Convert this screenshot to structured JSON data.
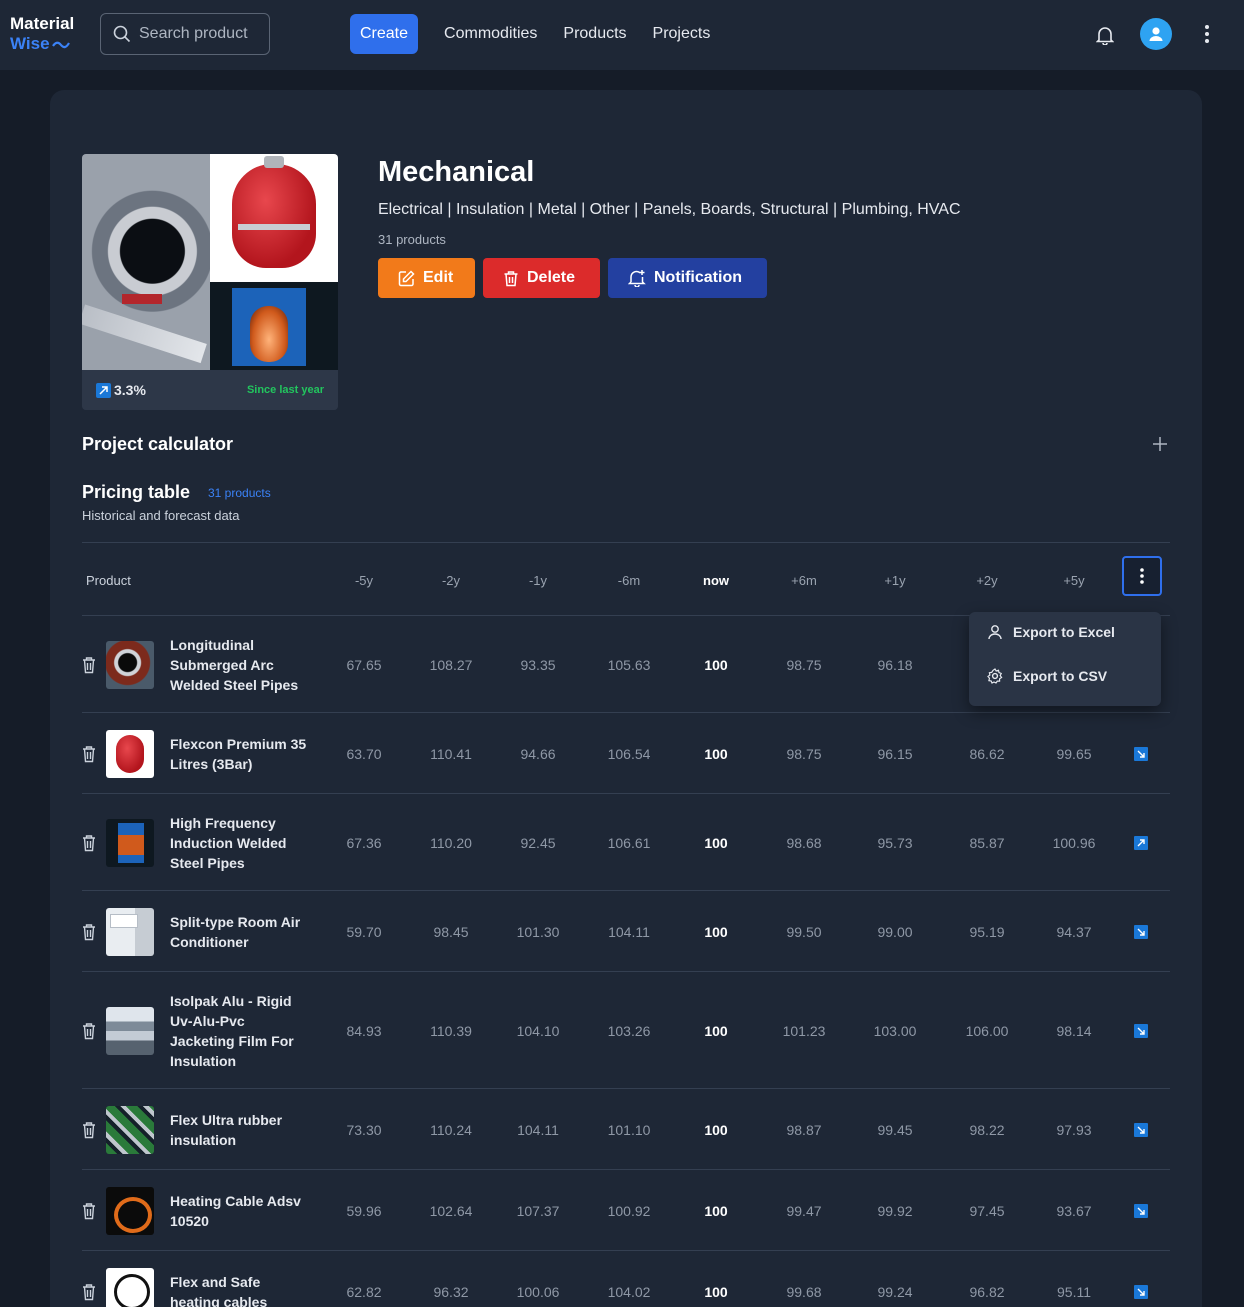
{
  "topbar": {
    "logo_line1": "Material",
    "logo_line2": "Wise",
    "search_placeholder": "Search product",
    "nav": {
      "create": "Create",
      "commodities": "Commodities",
      "products": "Products",
      "projects": "Projects"
    },
    "icons": [
      "search-icon",
      "bell-icon",
      "user-avatar-icon",
      "more-vertical-icon"
    ]
  },
  "category": {
    "title": "Mechanical",
    "subcategories": "Electrical | Insulation | Metal | Other | Panels, Boards, Structural | Plumbing, HVAC",
    "product_count": "31 products",
    "trend_value": "3.3%",
    "trend_label": "Since last year",
    "buttons": {
      "edit": "Edit",
      "delete": "Delete",
      "notification": "Notification"
    }
  },
  "project_calculator": {
    "title": "Project calculator",
    "add_icon": "plus-icon"
  },
  "pricing_table": {
    "title": "Pricing table",
    "count": "31 products",
    "subtitle": "Historical and forecast data",
    "columns": [
      "Product",
      "-5y",
      "-2y",
      "-1y",
      "-6m",
      "now",
      "+6m",
      "+1y",
      "+2y",
      "+5y"
    ],
    "rows": [
      {
        "name": "Longitudinal Submerged Arc Welded Steel Pipes",
        "values": [
          "67.65",
          "108.27",
          "93.35",
          "105.63",
          "100",
          "98.75",
          "96.18",
          "",
          ""
        ],
        "trend": ""
      },
      {
        "name": "Flexcon Premium 35 Litres (3Bar)",
        "values": [
          "63.70",
          "110.41",
          "94.66",
          "106.54",
          "100",
          "98.75",
          "96.15",
          "86.62",
          "99.65"
        ],
        "trend": "down"
      },
      {
        "name": "High Frequency Induction Welded Steel Pipes",
        "values": [
          "67.36",
          "110.20",
          "92.45",
          "106.61",
          "100",
          "98.68",
          "95.73",
          "85.87",
          "100.96"
        ],
        "trend": "up"
      },
      {
        "name": "Split-type Room Air Conditioner",
        "values": [
          "59.70",
          "98.45",
          "101.30",
          "104.11",
          "100",
          "99.50",
          "99.00",
          "95.19",
          "94.37"
        ],
        "trend": "down"
      },
      {
        "name": "Isolpak Alu - Rigid Uv-Alu-Pvc Jacketing Film For Insulation",
        "values": [
          "84.93",
          "110.39",
          "104.10",
          "103.26",
          "100",
          "101.23",
          "103.00",
          "106.00",
          "98.14"
        ],
        "trend": "down"
      },
      {
        "name": "Flex Ultra rubber insulation",
        "values": [
          "73.30",
          "110.24",
          "104.11",
          "101.10",
          "100",
          "98.87",
          "99.45",
          "98.22",
          "97.93"
        ],
        "trend": "down"
      },
      {
        "name": "Heating Cable Adsv 10520",
        "values": [
          "59.96",
          "102.64",
          "107.37",
          "100.92",
          "100",
          "99.47",
          "99.92",
          "97.45",
          "93.67"
        ],
        "trend": "down"
      },
      {
        "name": "Flex and Safe heating cables",
        "values": [
          "62.82",
          "96.32",
          "100.06",
          "104.02",
          "100",
          "99.68",
          "99.24",
          "96.82",
          "95.11"
        ],
        "trend": "down"
      }
    ]
  },
  "export_menu": {
    "excel": "Export to Excel",
    "csv": "Export to CSV"
  },
  "colors": {
    "background": "#151c28",
    "card": "#1e2736",
    "primary": "#2f6fec",
    "edit": "#f27a1a",
    "delete": "#dc2b2b",
    "notification": "#2340a0",
    "positive": "#22c55e"
  }
}
